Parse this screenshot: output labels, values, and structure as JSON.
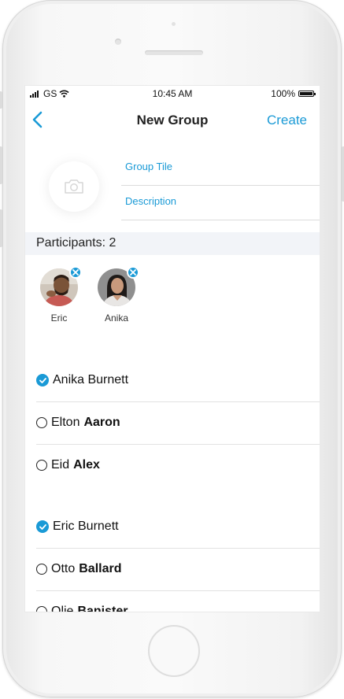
{
  "status_bar": {
    "carrier": "GS",
    "time": "10:45 AM",
    "battery": "100%",
    "battery_level": 1.0
  },
  "nav": {
    "title": "New Group",
    "action": "Create",
    "back_icon": "chevron-left-icon"
  },
  "form": {
    "title_placeholder": "Group Tile",
    "description_placeholder": "Description",
    "photo_icon": "camera-icon"
  },
  "participants": {
    "label": "Participants: 2",
    "selected": [
      {
        "name": "Eric"
      },
      {
        "name": "Anika"
      }
    ]
  },
  "contacts": {
    "section_a": [
      {
        "first": "Anika Burnett",
        "last": "",
        "checked": true
      },
      {
        "first": "Elton",
        "last": "Aaron",
        "checked": false
      },
      {
        "first": "Eid",
        "last": "Alex",
        "checked": false
      }
    ],
    "section_b": [
      {
        "first": "Eric Burnett",
        "last": "",
        "checked": true
      },
      {
        "first": "Otto",
        "last": "Ballard",
        "checked": false
      },
      {
        "first": "Olie",
        "last": "Banister",
        "checked": false
      }
    ]
  },
  "colors": {
    "accent": "#1a9ad6",
    "section_bg": "#f2f4f8"
  }
}
